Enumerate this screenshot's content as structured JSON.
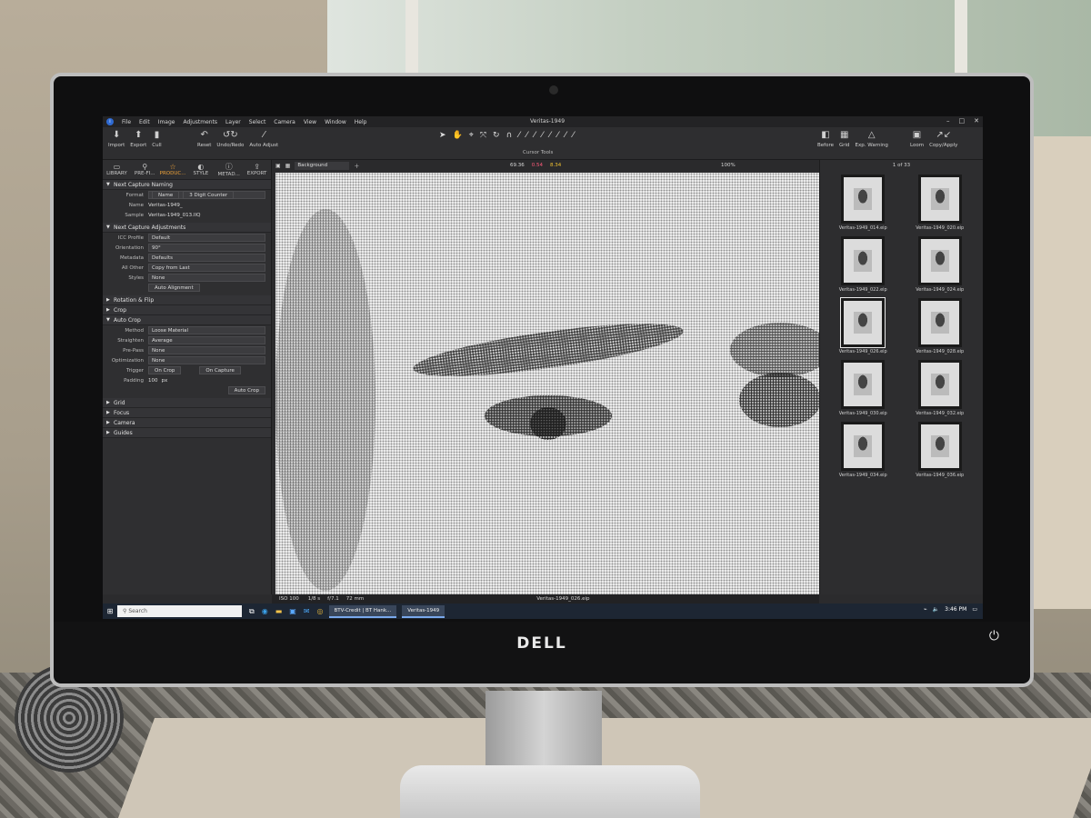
{
  "app": {
    "window_title": "Veritas-1949",
    "menu": [
      "File",
      "Edit",
      "Image",
      "Adjustments",
      "Layer",
      "Select",
      "Camera",
      "View",
      "Window",
      "Help"
    ]
  },
  "toolbar": {
    "left_buttons": [
      {
        "label": "Import",
        "icon": "import-icon",
        "glyph": "⬇"
      },
      {
        "label": "Export",
        "icon": "export-icon",
        "glyph": "⬆"
      },
      {
        "label": "Cull",
        "icon": "cull-icon",
        "glyph": "▮"
      },
      {
        "label": "Reset",
        "icon": "reset-icon",
        "glyph": "↶"
      },
      {
        "label": "Undo/Redo",
        "icon": "undo-redo-icon",
        "glyph": "↺↻"
      },
      {
        "label": "Auto Adjust",
        "icon": "auto-adjust-icon",
        "glyph": "⁄"
      }
    ],
    "cursor_tools_label": "Cursor Tools",
    "cursor_tools_glyphs": [
      "➤",
      "✋",
      "⌖",
      "⤧",
      "↻",
      "∩",
      "⁄",
      "⁄",
      "⁄",
      "⁄",
      "⁄",
      "⁄",
      "⁄",
      "⁄"
    ],
    "right_buttons": [
      {
        "label": "Before",
        "icon": "before-icon",
        "glyph": "◧"
      },
      {
        "label": "Grid",
        "icon": "grid-icon",
        "glyph": "▦"
      },
      {
        "label": "Exp. Warning",
        "icon": "exposure-warning-icon",
        "glyph": "△"
      },
      {
        "label": "Loom",
        "icon": "loom-icon",
        "glyph": "▣"
      },
      {
        "label": "Copy/Apply",
        "icon": "copy-apply-icon",
        "glyph": "↗↙"
      }
    ]
  },
  "tool_tabs": [
    {
      "label": "LIBRARY",
      "icon": "library-icon",
      "glyph": "▭"
    },
    {
      "label": "PRE-FI...",
      "icon": "pre-filter-icon",
      "glyph": "⚲"
    },
    {
      "label": "PRODUC...",
      "icon": "production-icon",
      "glyph": "☆",
      "active": true
    },
    {
      "label": "STYLE",
      "icon": "style-icon",
      "glyph": "◐"
    },
    {
      "label": "METAD...",
      "icon": "metadata-icon",
      "glyph": "ⓘ"
    },
    {
      "label": "EXPORT",
      "icon": "export-tab-icon",
      "glyph": "⇪"
    }
  ],
  "naming": {
    "title": "Next Capture Naming",
    "format_label": "Format",
    "format_name": "Name",
    "format_counter": "3 Digit Counter",
    "name_label": "Name",
    "name_value": "Veritas-1949_",
    "sample_label": "Sample",
    "sample_value": "Veritas-1949_013.IIQ"
  },
  "adjustments": {
    "title": "Next Capture Adjustments",
    "rows": [
      {
        "label": "ICC Profile",
        "value": "Default"
      },
      {
        "label": "Orientation",
        "value": "90°"
      },
      {
        "label": "Metadata",
        "value": "Defaults"
      },
      {
        "label": "All Other",
        "value": "Copy from Last"
      },
      {
        "label": "Styles",
        "value": "None"
      }
    ],
    "auto_alignment": "Auto Alignment"
  },
  "sections": {
    "rotation": "Rotation & Flip",
    "crop": "Crop",
    "autocrop": "Auto Crop",
    "grid": "Grid",
    "focus": "Focus",
    "camera": "Camera",
    "guides": "Guides"
  },
  "autocrop": {
    "rows": [
      {
        "label": "Method",
        "value": "Loose Material"
      },
      {
        "label": "Straighten",
        "value": "Average"
      },
      {
        "label": "Pre-Pass",
        "value": "None"
      },
      {
        "label": "Optimization",
        "value": "None"
      }
    ],
    "trigger_label": "Trigger",
    "trigger_on_crop": "On Crop",
    "trigger_on_capture": "On Capture",
    "padding_label": "Padding",
    "padding_value": "100",
    "padding_unit": "px",
    "button": "Auto Crop"
  },
  "viewer": {
    "layer": "Background",
    "stat_1": "69.36",
    "stat_2": "0.54",
    "stat_3": "8.34",
    "zoom": "100%",
    "filename": "Veritas-1949_026.eip",
    "status_iso": "ISO 100",
    "status_shutter": "1/8 s",
    "status_aperture": "f/7.1",
    "status_focal": "72 mm"
  },
  "browser": {
    "count": "1 of 33",
    "thumbs": [
      {
        "name": "Veritas-1949_014.eip",
        "selected": false
      },
      {
        "name": "Veritas-1949_020.eip",
        "selected": false
      },
      {
        "name": "Veritas-1949_022.eip",
        "selected": false
      },
      {
        "name": "Veritas-1949_024.eip",
        "selected": false
      },
      {
        "name": "Veritas-1949_026.eip",
        "selected": true
      },
      {
        "name": "Veritas-1949_028.eip",
        "selected": false
      },
      {
        "name": "Veritas-1949_030.eip",
        "selected": false
      },
      {
        "name": "Veritas-1949_032.eip",
        "selected": false
      },
      {
        "name": "Veritas-1949_034.eip",
        "selected": false
      },
      {
        "name": "Veritas-1949_036.eip",
        "selected": false
      }
    ]
  },
  "taskbar": {
    "search_placeholder": "Search",
    "task_browser": "BTV-Credit | BT Hank...",
    "task_app": "Veritas-1949",
    "time": "3:46 PM"
  },
  "brand": {
    "logo": "DELL"
  },
  "colors": {
    "accent": "#f0a33a",
    "stat_2": "#ff5a7a",
    "stat_3": "#f0c030"
  }
}
